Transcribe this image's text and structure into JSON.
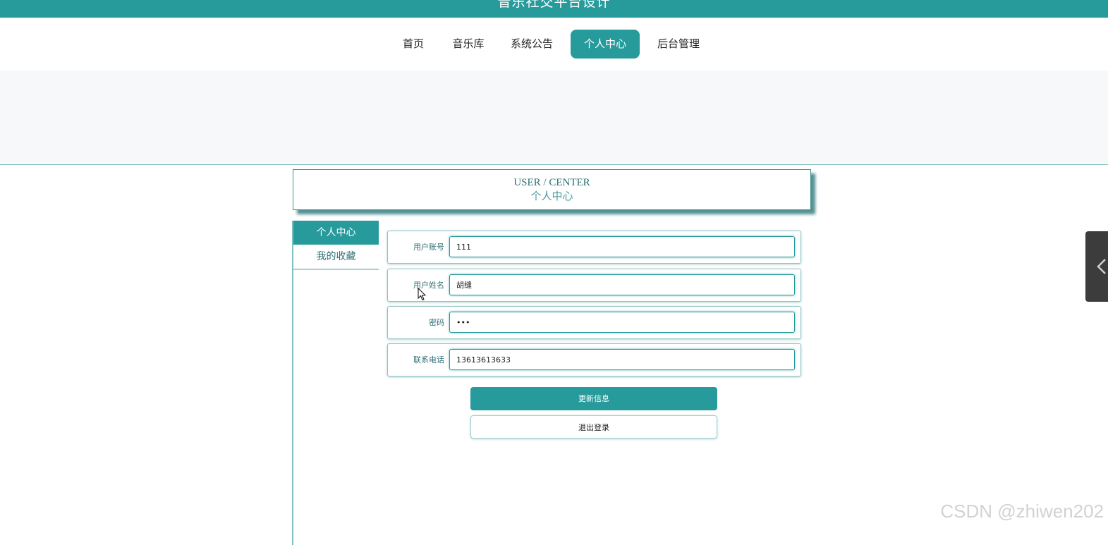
{
  "header": {
    "site_title": "音乐社交平台设计"
  },
  "nav": {
    "items": [
      {
        "label": "首页",
        "active": false
      },
      {
        "label": "音乐库",
        "active": false
      },
      {
        "label": "系统公告",
        "active": false
      },
      {
        "label": "个人中心",
        "active": true
      },
      {
        "label": "后台管理",
        "active": false
      }
    ]
  },
  "page_title": {
    "en": "USER / CENTER",
    "cn": "个人中心"
  },
  "sidebar": {
    "items": [
      {
        "label": "个人中心",
        "active": true
      },
      {
        "label": "我的收藏",
        "active": false
      }
    ]
  },
  "form": {
    "fields": [
      {
        "label": "用户账号",
        "value": "111",
        "type": "text"
      },
      {
        "label": "用户姓名",
        "value": "胡缝",
        "type": "text"
      },
      {
        "label": "密码",
        "value": "111",
        "type": "password"
      },
      {
        "label": "联系电话",
        "value": "13613613633",
        "type": "text"
      }
    ],
    "update_label": "更新信息",
    "logout_label": "退出登录"
  },
  "watermark": "CSDN @zhiwen202",
  "colors": {
    "primary": "#279b9c",
    "banner_bg": "#f7f8fa",
    "toggle_bg": "#3c3c3c"
  },
  "icons": {
    "side_toggle": "chevron-left-icon",
    "cursor": "mouse-pointer-icon"
  }
}
